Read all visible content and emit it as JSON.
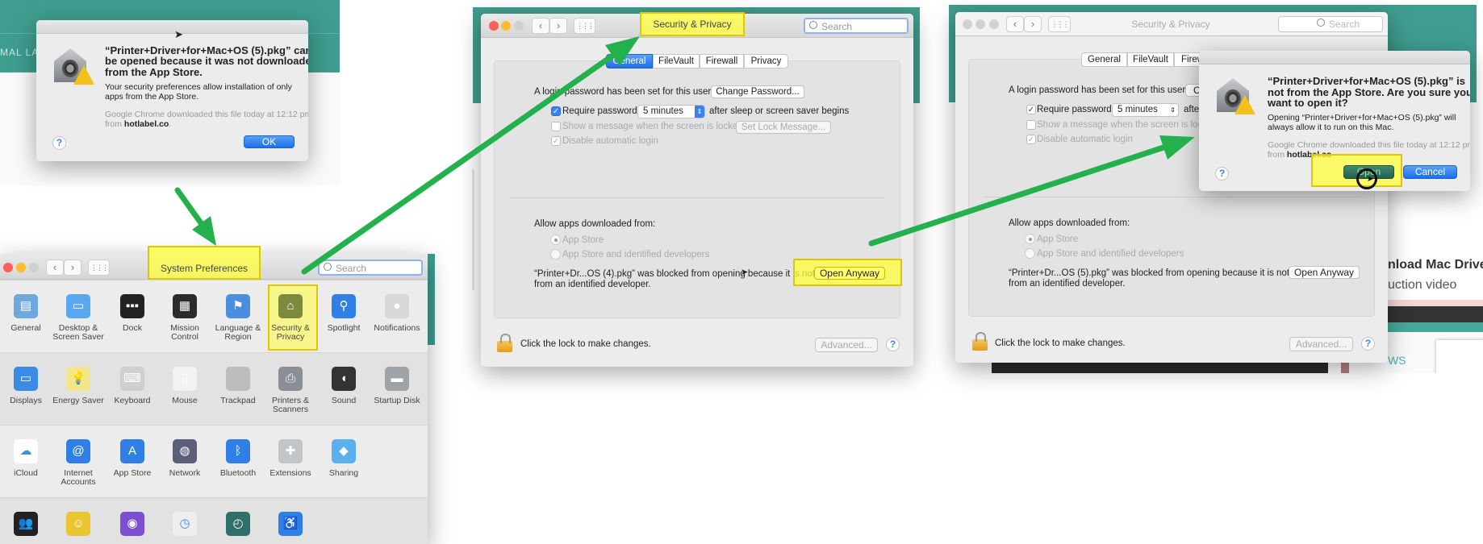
{
  "colors": {
    "accent": "#1d6fe9",
    "highlight": "#ffff3c",
    "arrow": "#22b14c",
    "teal": "#3f9d8f"
  },
  "top_dialog": {
    "bg_text": "MAL LAB",
    "title_lines": [
      "“Printer+Driver+for+Mac+OS (5).pkg” can’t",
      "be opened because it was not downloaded",
      "from the App Store."
    ],
    "body_lines": [
      "Your security preferences allow installation of only",
      "apps from the App Store."
    ],
    "source_line1": "Google Chrome downloaded this file today at 12:12 pm",
    "source_from": "from ",
    "source_host": "hotlabel.co",
    "source_end": ".",
    "ok_label": "OK",
    "help": "?"
  },
  "system_preferences": {
    "title": "System Preferences",
    "search_placeholder": "Search",
    "grid_icon": "⋮⋮⋮",
    "rows": [
      [
        {
          "label": "General",
          "icon": "general-icon",
          "color": "#6fa8dc",
          "glyph": "▤"
        },
        {
          "label": "Desktop & Screen Saver",
          "icon": "desktop-screen-saver-icon",
          "color": "#5aa9f0",
          "glyph": "▭"
        },
        {
          "label": "Dock",
          "icon": "dock-icon",
          "color": "#222",
          "glyph": "▪▪▪"
        },
        {
          "label": "Mission Control",
          "icon": "mission-control-icon",
          "color": "#2b2b2b",
          "glyph": "▦"
        },
        {
          "label": "Language & Region",
          "icon": "language-region-icon",
          "color": "#4b8ee0",
          "glyph": "⚑"
        },
        {
          "label": "Security & Privacy",
          "icon": "security-privacy-icon",
          "color": "#7d8a3c",
          "glyph": "⌂",
          "highlighted": true
        },
        {
          "label": "Spotlight",
          "icon": "spotlight-icon",
          "color": "#2f7fe6",
          "glyph": "⚲"
        },
        {
          "label": "Notifications",
          "icon": "notifications-icon",
          "color": "#d8d8d8",
          "glyph": "●"
        }
      ],
      [
        {
          "label": "Displays",
          "icon": "displays-icon",
          "color": "#3a8be6",
          "glyph": "▭"
        },
        {
          "label": "Energy Saver",
          "icon": "energy-saver-icon",
          "color": "#f3e58a",
          "glyph": "💡"
        },
        {
          "label": "Keyboard",
          "icon": "keyboard-icon",
          "color": "#cfcfcf",
          "glyph": "⌨"
        },
        {
          "label": "Mouse",
          "icon": "mouse-icon",
          "color": "#f2f2f2",
          "glyph": "▯"
        },
        {
          "label": "Trackpad",
          "icon": "trackpad-icon",
          "color": "#bdbdbd",
          "glyph": ""
        },
        {
          "label": "Printers & Scanners",
          "icon": "printer-icon",
          "color": "#8a8f95",
          "glyph": "⎙"
        },
        {
          "label": "Sound",
          "icon": "sound-icon",
          "color": "#333",
          "glyph": "◖"
        },
        {
          "label": "Startup Disk",
          "icon": "startup-disk-icon",
          "color": "#9ea3a8",
          "glyph": "▬"
        }
      ],
      [
        {
          "label": "iCloud",
          "icon": "icloud-icon",
          "color": "#ffffff",
          "glyph": "☁",
          "dark": true
        },
        {
          "label": "Internet Accounts",
          "icon": "internet-accounts-icon",
          "color": "#2f7fe6",
          "glyph": "@"
        },
        {
          "label": "App Store",
          "icon": "app-store-icon",
          "color": "#2f7fe6",
          "glyph": "A"
        },
        {
          "label": "Network",
          "icon": "network-icon",
          "color": "#5b5f7a",
          "glyph": "◍"
        },
        {
          "label": "Bluetooth",
          "icon": "bluetooth-icon",
          "color": "#2f7fe6",
          "glyph": "ᛒ"
        },
        {
          "label": "Extensions",
          "icon": "extensions-icon",
          "color": "#c3c6c9",
          "glyph": "✚"
        },
        {
          "label": "Sharing",
          "icon": "sharing-icon",
          "color": "#5cb0ee",
          "glyph": "◆"
        }
      ],
      [
        {
          "label": "",
          "icon": "users-groups-icon",
          "color": "#222",
          "glyph": "👥"
        },
        {
          "label": "",
          "icon": "parental-controls-icon",
          "color": "#e8c531",
          "glyph": "☺"
        },
        {
          "label": "",
          "icon": "siri-icon",
          "color": "#7a4fd0",
          "glyph": "◉"
        },
        {
          "label": "",
          "icon": "date-time-icon",
          "color": "#eeeeee",
          "glyph": "◷",
          "dark": true
        },
        {
          "label": "",
          "icon": "time-machine-icon",
          "color": "#2e6f6a",
          "glyph": "◴"
        },
        {
          "label": "",
          "icon": "accessibility-icon",
          "color": "#2f7fe6",
          "glyph": "♿"
        }
      ]
    ]
  },
  "security_privacy": {
    "title": "Security & Privacy",
    "search_placeholder": "Search",
    "tabs": [
      "General",
      "FileVault",
      "Firewall",
      "Privacy"
    ],
    "login_text": "A login password has been set for this user",
    "change_password": "Change Password...",
    "require_password": "Require password",
    "require_interval": "5 minutes",
    "after_text": "after sleep or screen saver begins",
    "show_message": "Show a message when the screen is locked",
    "set_lock_message": "Set Lock Message...",
    "disable_login": "Disable automatic login",
    "allow_label": "Allow apps downloaded from:",
    "option_app_store": "App Store",
    "option_identified": "App Store and identified developers",
    "blocked_line1": "“Printer+Dr...OS (4).pkg” was blocked from opening because it is not",
    "blocked_line2": "from an identified developer.",
    "open_anyway": "Open Anyway",
    "lock_text": "Click the lock to make changes.",
    "advanced": "Advanced...",
    "help": "?"
  },
  "security_privacy_2": {
    "title": "Security & Privacy",
    "search_placeholder": "Search",
    "tabs": [
      "General",
      "FileVault",
      "Firew"
    ],
    "login_text": "A login password has been set for this user",
    "change_partial": "C",
    "require_password": "Require password",
    "require_interval": "5 minutes",
    "after_partial": "afte",
    "show_message_partial": "Show a message when the screen is lock",
    "disable_login": "Disable automatic login",
    "allow_label": "Allow apps downloaded from:",
    "option_app_store": "App Store",
    "option_identified": "App Store and identified developers",
    "blocked_line1": "“Printer+Dr...OS (5).pkg” was blocked from opening because it is not",
    "blocked_line2": "from an identified developer.",
    "open_anyway": "Open Anyway",
    "lock_text": "Click the lock to make changes.",
    "advanced": "Advanced...",
    "help": "?"
  },
  "confirm_dialog": {
    "title_lines": [
      "“Printer+Driver+for+Mac+OS (5).pkg” is",
      "not from the App Store. Are you sure you",
      "want to open it?"
    ],
    "body_lines": [
      "Opening “Printer+Driver+for+Mac+OS (5).pkg” will",
      "always allow it to run on this Mac."
    ],
    "source_line1": "Google Chrome downloaded this file today at 12:12 pm",
    "source_from": "from ",
    "source_host": "hotlabel.co",
    "open_label": "Open",
    "cancel_label": "Cancel",
    "help": "?"
  },
  "background_page": {
    "heading_partial": "nload Mac Driver",
    "subheading_partial": "uction video",
    "thumb_text": "WS"
  }
}
